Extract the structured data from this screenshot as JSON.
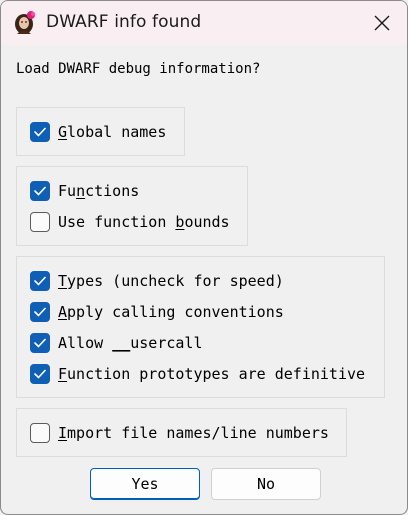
{
  "window": {
    "title": "DWARF info found",
    "close_icon": "close-icon"
  },
  "prompt": "Load DWARF debug information?",
  "groups": {
    "names": {
      "global_names": {
        "pre": "",
        "key": "G",
        "post": "lobal names",
        "checked": true
      }
    },
    "functions": {
      "functions": {
        "pre": "Fu",
        "key": "n",
        "post": "ctions",
        "checked": true
      },
      "function_bounds": {
        "pre": "Use function ",
        "key": "b",
        "post": "ounds",
        "checked": false
      }
    },
    "types": {
      "types": {
        "pre": "",
        "key": "T",
        "post": "ypes (uncheck for speed)",
        "checked": true
      },
      "calling_conventions": {
        "pre": "",
        "key": "A",
        "post": "pply calling conventions",
        "checked": true
      },
      "usercall": {
        "pre": "Allow ",
        "key": "__",
        "post": "usercall",
        "checked": true
      },
      "prototypes": {
        "pre": "",
        "key": "F",
        "post": "unction prototypes are definitive",
        "checked": true
      }
    },
    "files": {
      "import_files": {
        "pre": "",
        "key": "I",
        "post": "mport file names/line numbers",
        "checked": false
      }
    }
  },
  "buttons": {
    "yes": "Yes",
    "no": "No"
  },
  "colors": {
    "accent": "#0f5fb5",
    "titlebar": "#f9eef1",
    "background": "#f0f0f0"
  }
}
